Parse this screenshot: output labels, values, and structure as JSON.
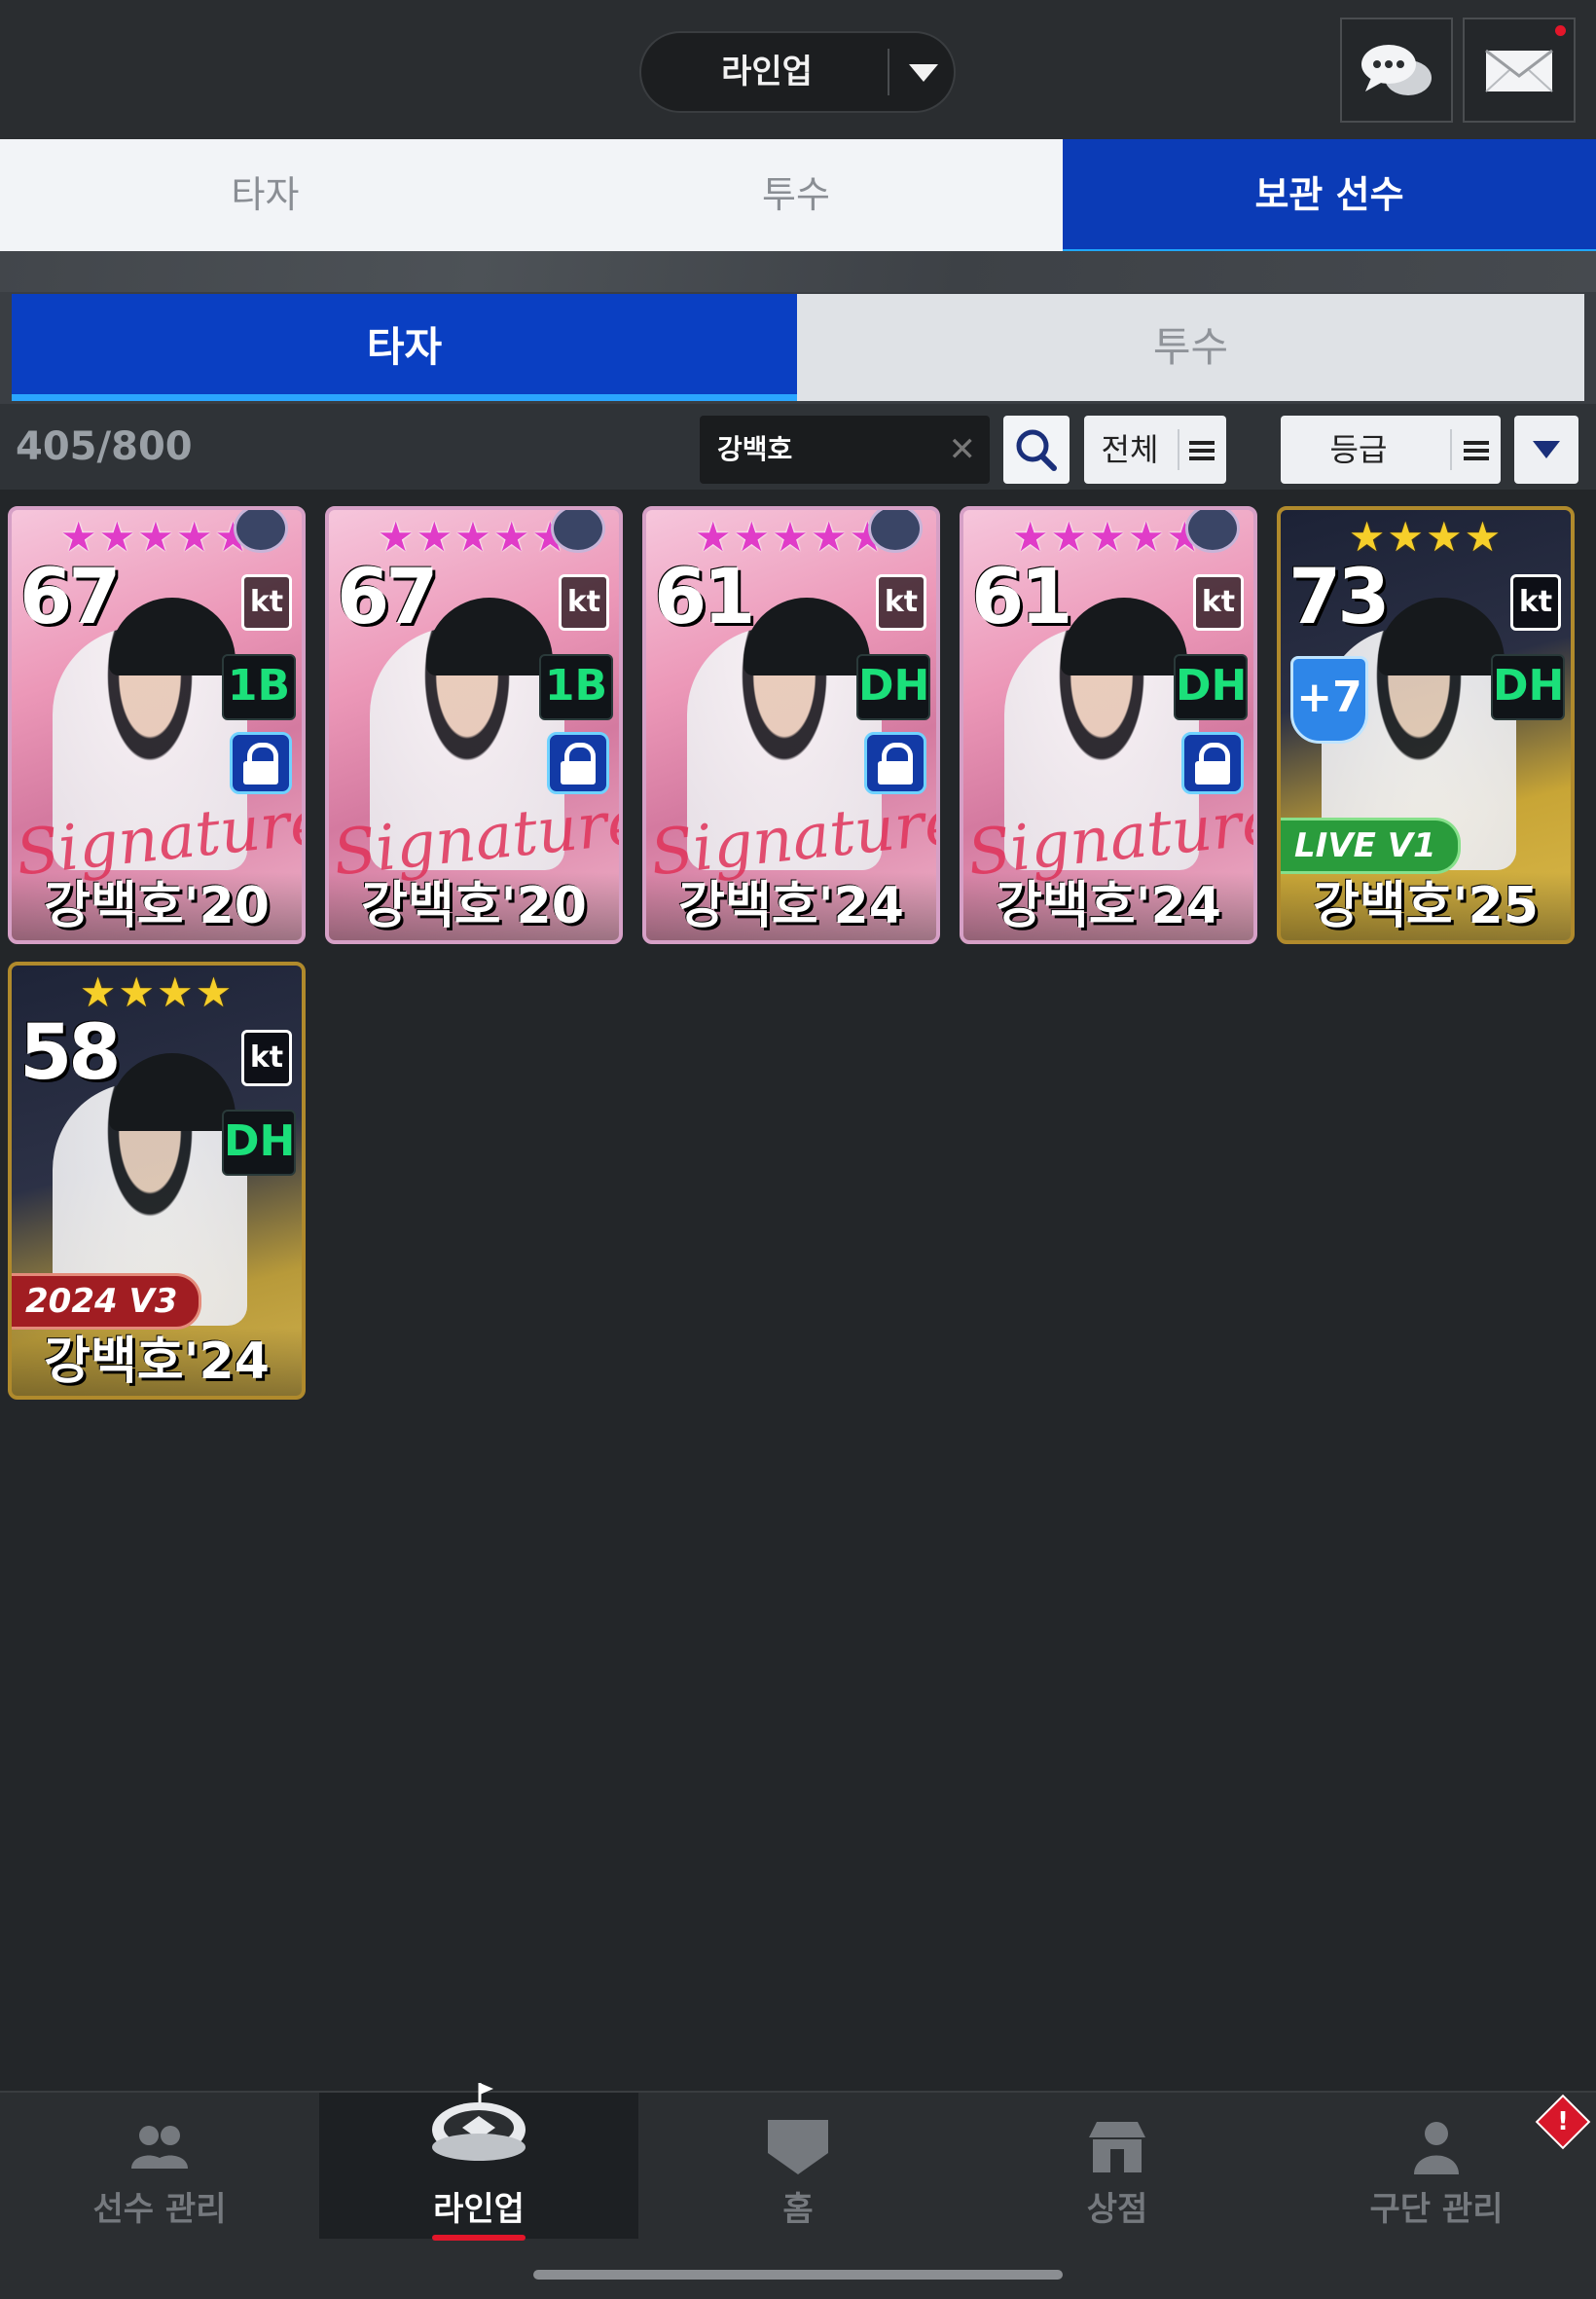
{
  "header": {
    "lineup_select": "라인업"
  },
  "top_tabs": [
    {
      "label": "타자",
      "active": false
    },
    {
      "label": "투수",
      "active": false
    },
    {
      "label": "보관 선수",
      "active": true
    }
  ],
  "sub_tabs": [
    {
      "label": "타자",
      "active": true
    },
    {
      "label": "투수",
      "active": false
    }
  ],
  "filter": {
    "count": "405/800",
    "search_value": "강백호",
    "filter_all": "전체",
    "sort_grade": "등급"
  },
  "cards": [
    {
      "stars": "★★★★★",
      "ovr": "67",
      "team": "kt",
      "position": "1B",
      "locked": true,
      "edition": "Signature",
      "name": "강백호'20"
    },
    {
      "stars": "★★★★★",
      "ovr": "67",
      "team": "kt",
      "position": "1B",
      "locked": true,
      "edition": "Signature",
      "name": "강백호'20"
    },
    {
      "stars": "★★★★★",
      "ovr": "61",
      "team": "kt",
      "position": "DH",
      "locked": true,
      "edition": "Signature",
      "name": "강백호'24"
    },
    {
      "stars": "★★★★★",
      "ovr": "61",
      "team": "kt",
      "position": "DH",
      "locked": true,
      "edition": "Signature",
      "name": "강백호'24"
    },
    {
      "stars": "★★★★",
      "ovr": "73",
      "team": "kt",
      "position": "DH",
      "enhance": "+7",
      "edition": "LIVE V1",
      "name": "강백호'25"
    },
    {
      "stars": "★★★★",
      "ovr": "58",
      "team": "kt",
      "position": "DH",
      "edition": "2024 V3",
      "name": "강백호'24"
    }
  ],
  "bottom_nav": [
    {
      "label": "선수 관리",
      "icon": "players-icon",
      "active": false
    },
    {
      "label": "라인업",
      "icon": "stadium-icon",
      "active": true
    },
    {
      "label": "홈",
      "icon": "home-plate-icon",
      "active": false
    },
    {
      "label": "상점",
      "icon": "shop-icon",
      "active": false
    },
    {
      "label": "구단 관리",
      "icon": "manager-icon",
      "active": false
    }
  ],
  "alert_badge": "!",
  "colors": {
    "active_tab": "#0b3bb6",
    "tab_underline": "#1fa7ff",
    "position_text": "#1be07a",
    "alert": "#d8172a"
  }
}
